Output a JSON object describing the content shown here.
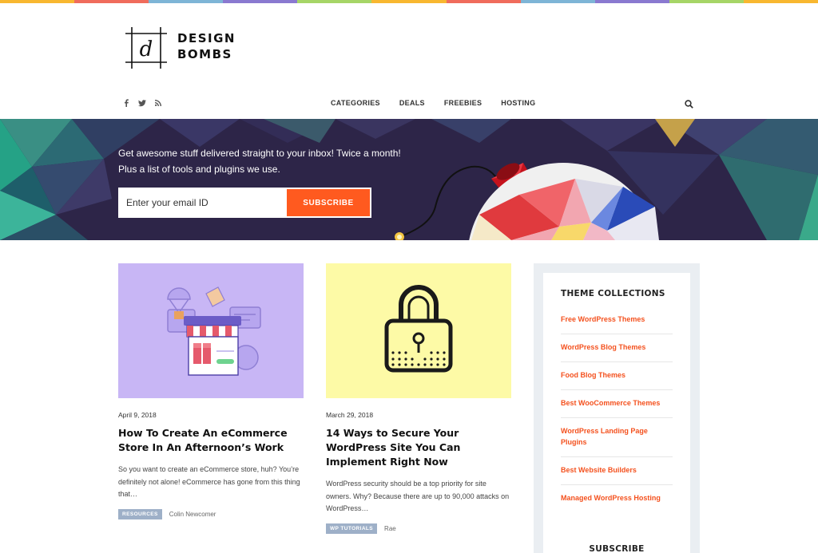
{
  "brand": {
    "logo_letter": "d",
    "logo_line1": "DESIGN",
    "logo_line2": "BOMBS",
    "accent": "#ff5a1f",
    "rainbow": [
      "#f8b730",
      "#f06c5c",
      "#7eb5d6",
      "#8a79d0",
      "#a6d567",
      "#f8b730",
      "#f06c5c",
      "#7eb5d6",
      "#8a79d0",
      "#a6d567",
      "#f8b730"
    ]
  },
  "social": [
    {
      "name": "facebook-icon",
      "glyph": "f"
    },
    {
      "name": "twitter-icon",
      "glyph": "t"
    },
    {
      "name": "rss-icon",
      "glyph": "rss"
    }
  ],
  "nav": {
    "items": [
      "CATEGORIES",
      "DEALS",
      "FREEBIES",
      "HOSTING"
    ],
    "search_icon": "search-icon"
  },
  "hero": {
    "line1": "Get awesome stuff delivered straight to your inbox! Twice a month!",
    "line2": "Plus a list of tools and plugins we use.",
    "email_placeholder": "Enter your email ID",
    "subscribe_label": "SUBSCRIBE"
  },
  "posts": [
    {
      "date": "April 9, 2018",
      "title": "How To Create An eCommerce Store In An Afternoon’s Work",
      "excerpt": "So you want to create an eCommerce store, huh? You’re definitely not alone! eCommerce has gone from this thing that…",
      "tag": "RESOURCES",
      "author": "Colin Newcomer",
      "image_bg": "#c8b6f5",
      "image_icon": "storefront-icon"
    },
    {
      "date": "March 29, 2018",
      "title": "14 Ways to Secure Your WordPress Site You Can Implement Right Now",
      "excerpt": "WordPress security should be a top priority for site owners. Why? Because there are up to 90,000 attacks on WordPress…",
      "tag": "WP TUTORIALS",
      "author": "Rae",
      "image_bg": "#fdfaa6",
      "image_icon": "padlock-icon"
    }
  ],
  "sidebar": {
    "title": "THEME COLLECTIONS",
    "links": [
      "Free WordPress Themes",
      "WordPress Blog Themes",
      "Food Blog Themes",
      "Best WooCommerce Themes",
      "WordPress Landing Page Plugins",
      "Best Website Builders",
      "Managed WordPress Hosting"
    ],
    "subscribe_title": "SUBSCRIBE"
  }
}
